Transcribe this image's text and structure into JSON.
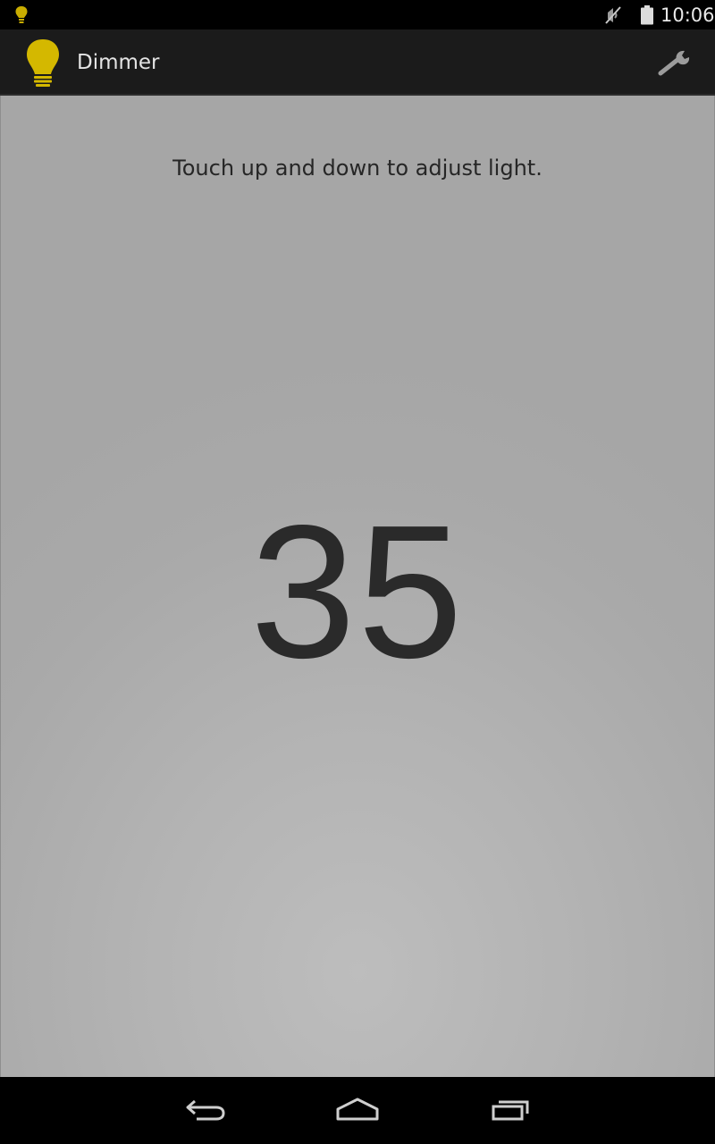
{
  "status_bar": {
    "time": "10:06",
    "icons": [
      "lightbulb-notification-icon",
      "mute-icon",
      "battery-icon"
    ]
  },
  "action_bar": {
    "title": "Dimmer",
    "app_icon": "lightbulb-icon",
    "settings_icon": "wrench-icon"
  },
  "main": {
    "instruction": "Touch up and down to adjust light.",
    "level": "35"
  },
  "nav_bar": {
    "buttons": [
      "back-icon",
      "home-icon",
      "recents-icon"
    ]
  },
  "colors": {
    "bulb_yellow": "#d4b800",
    "action_bar_bg": "#1b1b1b",
    "content_bg": "#b0b0b0",
    "text_dark": "#2a2a2a"
  }
}
